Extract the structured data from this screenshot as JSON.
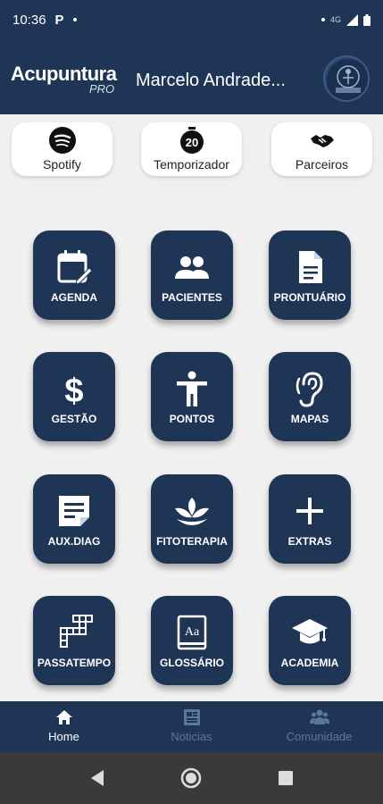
{
  "status_bar": {
    "time": "10:36",
    "app_indicator": "P",
    "network": "4G"
  },
  "header": {
    "logo_main": "Acupuntura",
    "logo_sub": "PRO",
    "user_name": "Marcelo Andrade...",
    "avatar_icon": "profile-logo-icon"
  },
  "quick_actions": [
    {
      "label": "Spotify",
      "icon": "spotify-icon"
    },
    {
      "label": "Temporizador",
      "icon": "timer-20-icon",
      "badge": "20"
    },
    {
      "label": "Parceiros",
      "icon": "handshake-icon"
    }
  ],
  "tiles": [
    {
      "label": "AGENDA",
      "icon": "calendar-edit-icon"
    },
    {
      "label": "PACIENTES",
      "icon": "people-icon"
    },
    {
      "label": "PRONTUÁRIO",
      "icon": "document-icon"
    },
    {
      "label": "GESTÃO",
      "icon": "dollar-icon"
    },
    {
      "label": "PONTOS",
      "icon": "body-icon"
    },
    {
      "label": "MAPAS",
      "icon": "ear-icon"
    },
    {
      "label": "AUX.DIAG",
      "icon": "note-icon"
    },
    {
      "label": "FITOTERAPIA",
      "icon": "plant-icon"
    },
    {
      "label": "EXTRAS",
      "icon": "plus-icon"
    },
    {
      "label": "PASSATEMPO",
      "icon": "crossword-icon"
    },
    {
      "label": "GLOSSÁRIO",
      "icon": "dictionary-icon",
      "icon_text": "Aa"
    },
    {
      "label": "ACADEMIA",
      "icon": "graduation-cap-icon"
    }
  ],
  "bottom_nav": [
    {
      "label": "Home",
      "icon": "home-icon",
      "active": true
    },
    {
      "label": "Noticias",
      "icon": "news-icon",
      "active": false
    },
    {
      "label": "Comunidade",
      "icon": "community-icon",
      "active": false
    }
  ],
  "colors": {
    "primary": "#1f3556",
    "background": "#f0f0f0",
    "inactive_nav": "#5f7797"
  }
}
